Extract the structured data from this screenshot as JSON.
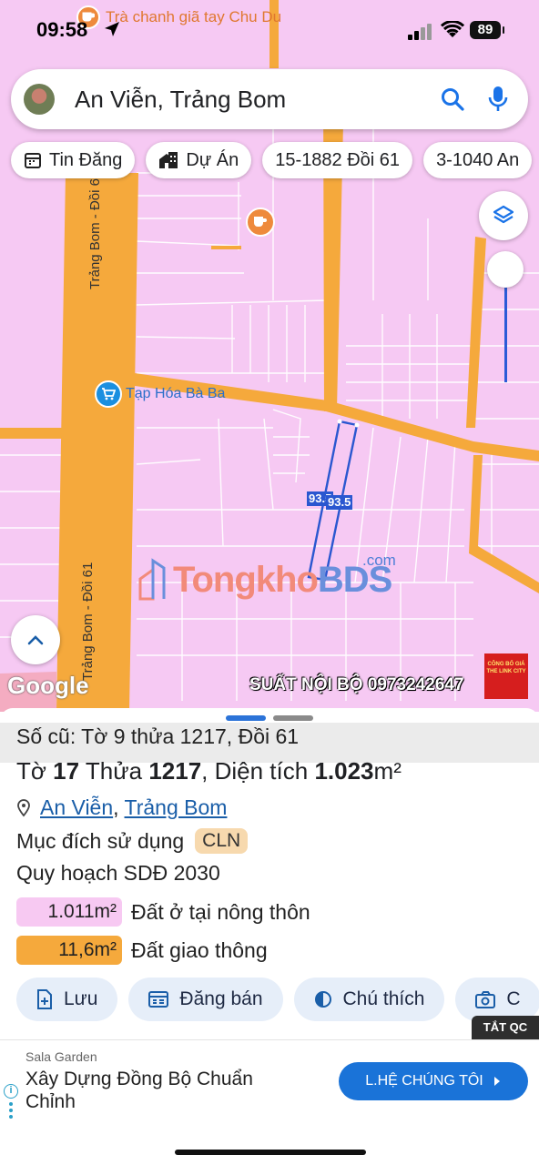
{
  "status": {
    "time": "09:58",
    "battery": "89"
  },
  "map": {
    "top_poi": "Trà chanh giã tay Chu Du",
    "poi_shop": "Tạp Hóa Bà Ba",
    "road_upper": "Trảng Bom - Đồi 61",
    "road_lower": "Trảng Bom - Đồi 61",
    "lot_dim_left": "93.5",
    "lot_dim_right": "93.5",
    "watermark_main": "TongkhoBDS",
    "watermark_domain": ".com",
    "google_logo": "Google",
    "promo_text": "SUẤT NỘI BỘ 0973242647",
    "promo_badge": "CÔNG BỐ GIÁ THE LINK CITY",
    "colors": {
      "land": "#f6c9f3",
      "road": "#f5a93c",
      "lot_outline": "#2a57d0"
    }
  },
  "search": {
    "value": "An Viễn, Trảng Bom"
  },
  "chips": [
    {
      "label": "Tin Đăng",
      "icon": "calendar-icon"
    },
    {
      "label": "Dự Án",
      "icon": "building-icon"
    },
    {
      "label": "15-1882 Đồi 61"
    },
    {
      "label": "3-1040 An"
    }
  ],
  "sheet": {
    "old_record": "Số cũ: Tờ 9 thửa 1217, Đồi 61",
    "title": {
      "to_label": "Tờ",
      "to_value": "17",
      "thua_label": "Thửa",
      "thua_value": "1217",
      "area_label": ", Diện tích",
      "area_value": "1.023",
      "area_unit": "m²"
    },
    "address": {
      "commune": "An Viễn",
      "sep": ",",
      "district": "Trảng Bom"
    },
    "purpose_label": "Mục đích sử dụng",
    "purpose_code": "CLN",
    "plan_label": "Quy hoạch SDĐ 2030",
    "legend": [
      {
        "area": "1.011m²",
        "label": "Đất ở tại nông thôn",
        "color": "#f7c9f2"
      },
      {
        "area": "11,6m²",
        "label": "Đất giao thông",
        "color": "#f5a93c"
      }
    ],
    "actions": [
      {
        "label": "Lưu",
        "icon": "add-file-icon"
      },
      {
        "label": "Đăng bán",
        "icon": "listing-icon"
      },
      {
        "label": "Chú thích",
        "icon": "contrast-icon"
      },
      {
        "label": "C",
        "icon": "camera-icon"
      }
    ]
  },
  "ad": {
    "close_label": "TẮT QC",
    "brand": "Sala Garden",
    "title": "Xây Dựng Đồng Bộ Chuẩn Chỉnh",
    "cta": "L.HỆ CHÚNG TÔI",
    "info": "i"
  }
}
